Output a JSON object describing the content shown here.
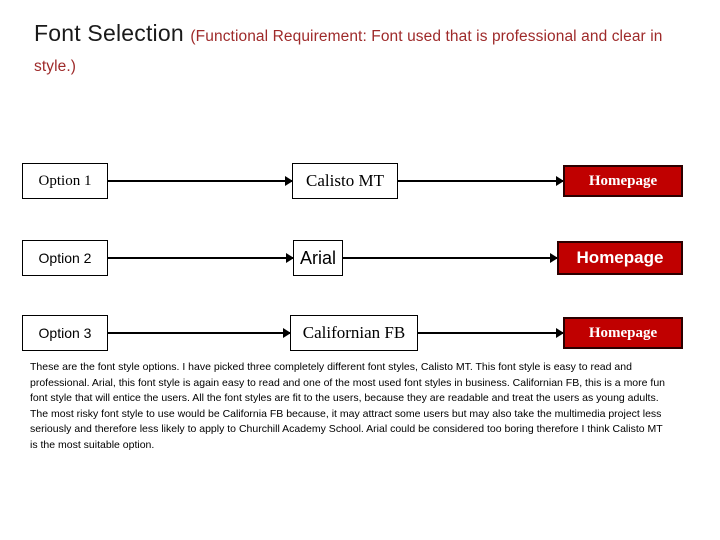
{
  "title": {
    "main": "Font Selection ",
    "sub": "(Functional Requirement: Font used that is professional and clear in style.)"
  },
  "colors": {
    "accent_red_fill": "#c00000",
    "title_red_text": "#9e2a2a",
    "node_border": "#000000",
    "red_node_border": "#2b0000",
    "page_background": "#ffffff"
  },
  "diagram": {
    "rows": [
      {
        "option_label": "Option 1",
        "font_label": "Calisto MT",
        "destination_label": "Homepage"
      },
      {
        "option_label": "Option 2",
        "font_label": "Arial",
        "destination_label": "Homepage"
      },
      {
        "option_label": "Option 3",
        "font_label": "Californian FB",
        "destination_label": "Homepage"
      }
    ]
  },
  "body": {
    "paragraph": "These are the font style options. I have picked three completely different font styles, Calisto MT. This font style is easy to read and professional. Arial, this font style is again easy to read and one of the most used font styles in business. Californian FB, this is a more fun font style that will entice the users. All the font styles are fit to the users, because they are readable and treat the users as young adults. The most risky font style to use would be California FB because, it may attract some users but may also take the multimedia project less seriously and therefore less likely to apply to Churchill Academy School. Arial could be considered too boring therefore I think Calisto MT is the most suitable option."
  }
}
